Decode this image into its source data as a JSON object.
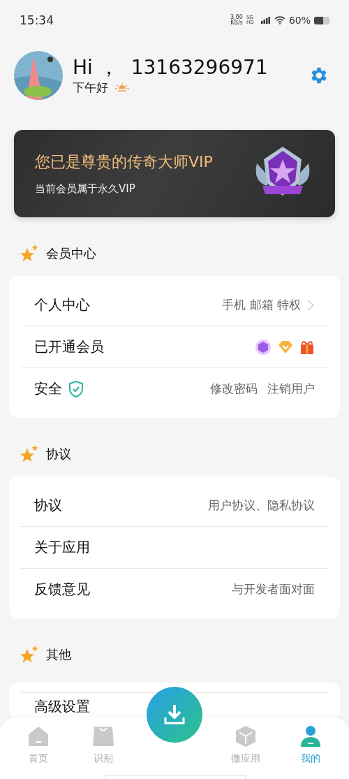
{
  "status_bar": {
    "time": "15:34",
    "speed": "3.60",
    "speed_unit": "KB/s",
    "network": "5G HD",
    "battery": "60%"
  },
  "profile": {
    "greeting": "Hi ，",
    "phone": "13163296971",
    "subtitle": "下午好"
  },
  "vip_card": {
    "title": "您已是尊贵的传奇大师VIP",
    "subtitle": "当前会员属于永久VIP"
  },
  "sections": [
    {
      "title": "会员中心",
      "rows": [
        {
          "kind": "detail",
          "label": "个人中心",
          "details": [
            "手机 邮箱 特权"
          ],
          "chevron": true
        },
        {
          "kind": "badges",
          "label": "已开通会员",
          "details": [],
          "chevron": false
        },
        {
          "kind": "shield",
          "label": "安全",
          "details": [
            "修改密码",
            "注销用户"
          ],
          "chevron": false
        }
      ]
    },
    {
      "title": "协议",
      "rows": [
        {
          "kind": "detail",
          "label": "协议",
          "details": [
            "用户协议、隐私协议"
          ],
          "chevron": false
        },
        {
          "kind": "detail",
          "label": "关于应用",
          "details": [],
          "chevron": false
        },
        {
          "kind": "detail",
          "label": "反馈意见",
          "details": [
            "与开发者面对面"
          ],
          "chevron": false
        }
      ]
    },
    {
      "title": "其他",
      "rows": [
        {
          "kind": "detail",
          "label": "高级设置",
          "details": [],
          "chevron": false
        }
      ]
    }
  ],
  "bottom_nav": [
    {
      "kind": "home",
      "label": "首页",
      "selected": false
    },
    {
      "kind": "bag",
      "label": "识别",
      "selected": false
    },
    {
      "kind": "fab"
    },
    {
      "kind": "cube",
      "label": "微应用",
      "selected": false
    },
    {
      "kind": "person",
      "label": "我的",
      "selected": true
    }
  ]
}
